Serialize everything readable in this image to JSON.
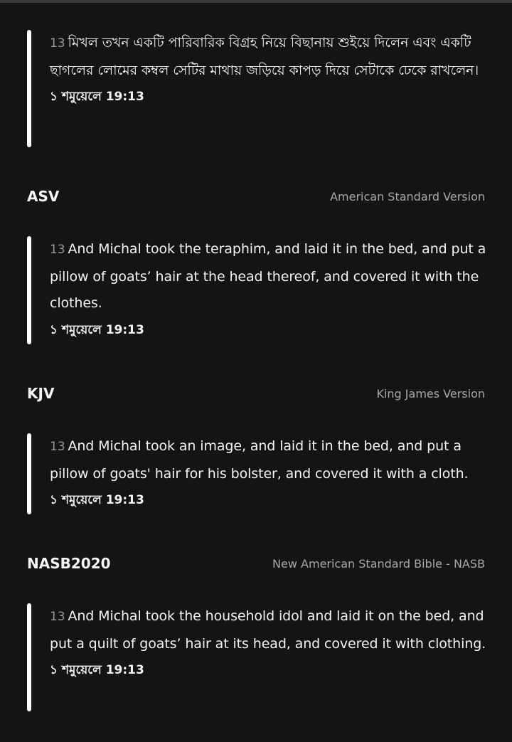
{
  "entries": [
    {
      "verse_number": "13",
      "text": "মিখল তখন একটি পারিবারিক বিগ্রহ নিয়ে বিছানায় শুইয়ে দিলেন এবং একটি ছাগলের লোমের কম্বল সেটির মাথায় জড়িয়ে কাপড় দিয়ে সেটাকে ঢেকে রাখলেন।",
      "reference": "১ শমুয়েলে 19:13"
    },
    {
      "version_abbr": "ASV",
      "version_name": "American Standard Version",
      "verse_number": "13",
      "text": "And Michal took the teraphim, and laid it in the bed, and put a pillow of goats’ hair at the head thereof, and covered it with the clothes.",
      "reference": "১ শমুয়েলে 19:13"
    },
    {
      "version_abbr": "KJV",
      "version_name": "King James Version",
      "verse_number": "13",
      "text": "And Michal took an image, and laid it in the bed, and put a pillow of goats' hair for his bolster, and covered it with a cloth.",
      "reference": "১ শমুয়েলে 19:13"
    },
    {
      "version_abbr": "NASB2020",
      "version_name": "New American Standard Bible - NASB",
      "verse_number": "13",
      "text": "And Michal took the household idol and laid it on the bed, and put a quilt of goats’ hair at its head, and covered it with clothing.",
      "reference": "১ শমুয়েলে 19:13"
    }
  ]
}
